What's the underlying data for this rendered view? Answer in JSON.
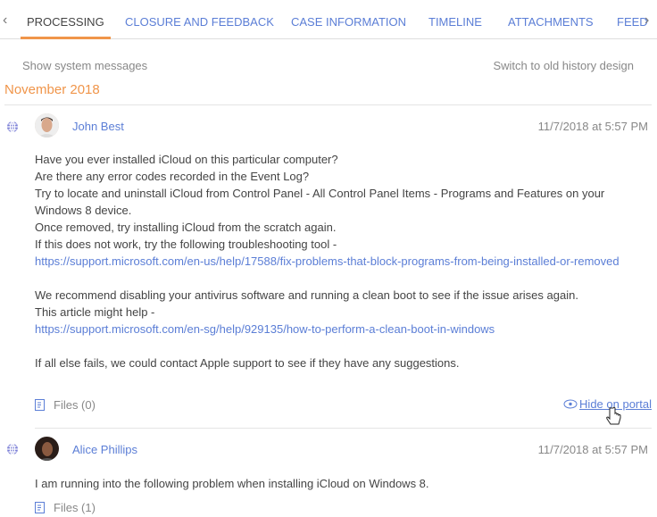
{
  "tabs": [
    {
      "label": "PROCESSING",
      "active": true
    },
    {
      "label": "CLOSURE AND FEEDBACK"
    },
    {
      "label": "CASE INFORMATION"
    },
    {
      "label": "TIMELINE"
    },
    {
      "label": "ATTACHMENTS"
    },
    {
      "label": "FEED"
    }
  ],
  "toolbar": {
    "show_system": "Show system messages",
    "switch_design": "Switch to old history design"
  },
  "month": "November 2018",
  "colors": {
    "accent": "#f0954a",
    "link": "#5b7ed6"
  },
  "messages": [
    {
      "author": "John Best",
      "date": "11/7/2018 at 5:57 PM",
      "lines": [
        "Have you ever installed iCloud on this particular computer?",
        "Are there any error codes recorded in the Event Log?",
        "Try to locate and uninstall iCloud from Control Panel - All Control Panel Items - Programs and Features on your Windows 8 device.",
        "Once removed, try installing iCloud from the scratch again.",
        "If this does not work, try the following troubleshooting tool -"
      ],
      "link1": "https://support.microsoft.com/en-us/help/17588/fix-problems-that-block-programs-from-being-installed-or-removed",
      "lines2": [
        "We recommend disabling your antivirus software and running a clean boot to see if the issue arises again.",
        "This article might help -"
      ],
      "link2": "https://support.microsoft.com/en-sg/help/929135/how-to-perform-a-clean-boot-in-windows",
      "last": "If all else fails, we could contact Apple support to see if they have any suggestions.",
      "files": "Files (0)",
      "hide": "Hide on portal"
    },
    {
      "author": "Alice Phillips",
      "date": "11/7/2018 at 5:57 PM",
      "text": "I am running into the following problem when installing iCloud on Windows 8.",
      "files": "Files (1)"
    }
  ]
}
